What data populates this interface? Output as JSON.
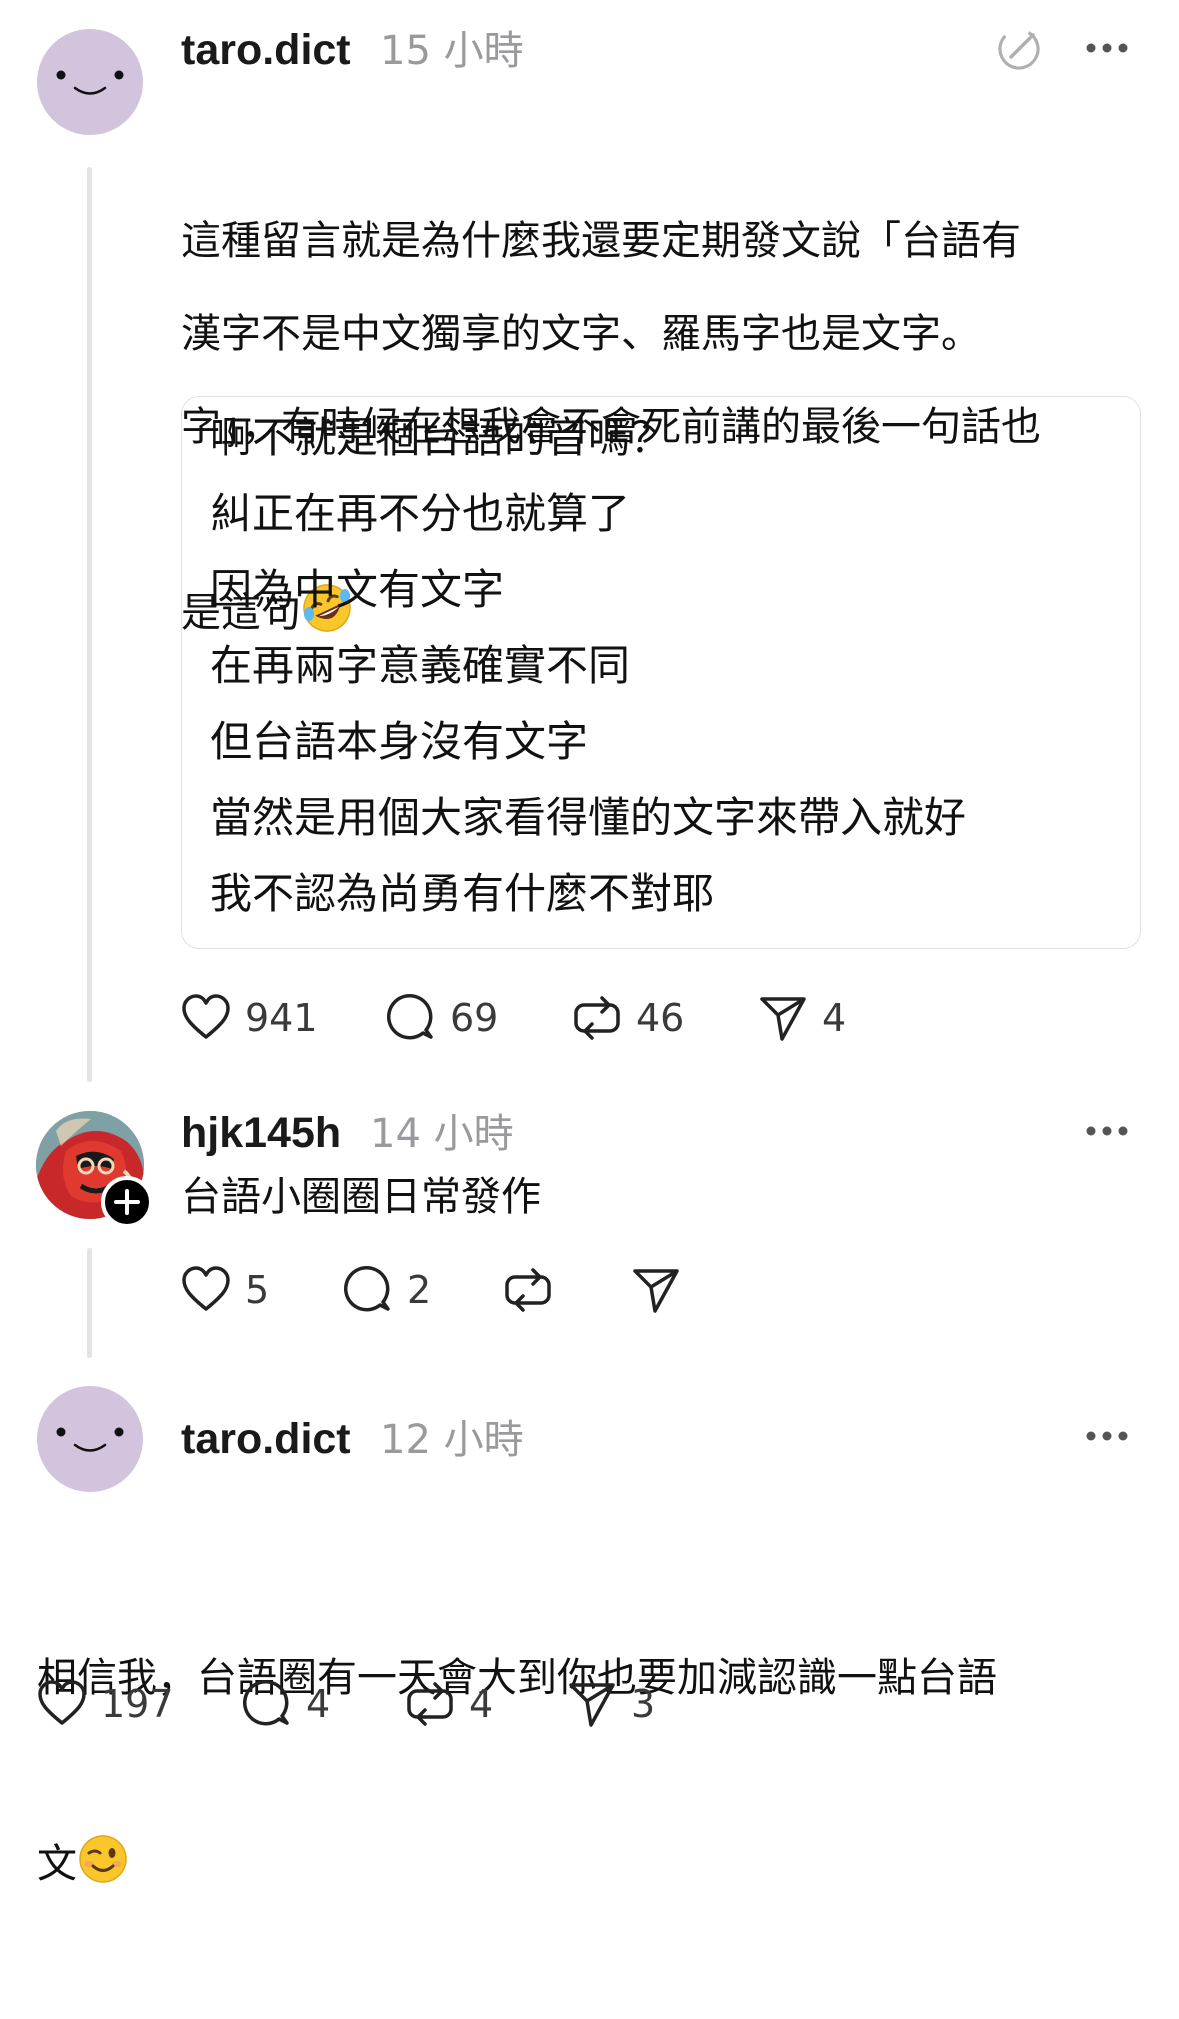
{
  "posts": [
    {
      "username": "taro.dict",
      "time": "15 小時",
      "text_lines": [
        "這種留言就是為什麼我還要定期發文說「台語有",
        "字」，有時候在想我會不會死前講的最後一句話也",
        "是這句"
      ],
      "text_emoji": "rolling-on-floor-laughing",
      "text_para2": "漢字不是中文獨享的文字、羅馬字也是文字。",
      "quote_lines": [
        "啊不就是個台語的音嗎？",
        "糾正在再不分也就算了",
        "因為中文有文字",
        "在再兩字意義確實不同",
        "但台語本身沒有文字",
        "當然是用個大家看得懂的文字來帶入就好",
        "我不認為尚勇有什麼不對耶"
      ],
      "likes": "941",
      "replies": "69",
      "reposts": "46",
      "shares": "4"
    },
    {
      "username": "hjk145h",
      "time": "14 小時",
      "text": "台語小圈圈日常發作",
      "likes": "5",
      "replies": "2",
      "reposts": "",
      "shares": ""
    },
    {
      "username": "taro.dict",
      "time": "12 小時",
      "text_lines": [
        "相信我，台語圈有一天會大到你也要加減認識一點台語",
        "文"
      ],
      "text_emoji": "winking-face",
      "likes": "197",
      "replies": "4",
      "reposts": "4",
      "shares": "3"
    }
  ],
  "colors": {
    "background": "#ffffff",
    "text": "#111111",
    "muted": "#9a9a9e",
    "avatar_purple": "#d2c4dc",
    "divider": "#e4e4e6"
  },
  "icons": {
    "edit": "pencil-circle-icon",
    "more": "more-dots-icon",
    "like": "heart-icon",
    "reply": "comment-bubble-icon",
    "repost": "repost-arrows-icon",
    "share": "paper-plane-icon",
    "follow": "plus-badge-icon"
  }
}
